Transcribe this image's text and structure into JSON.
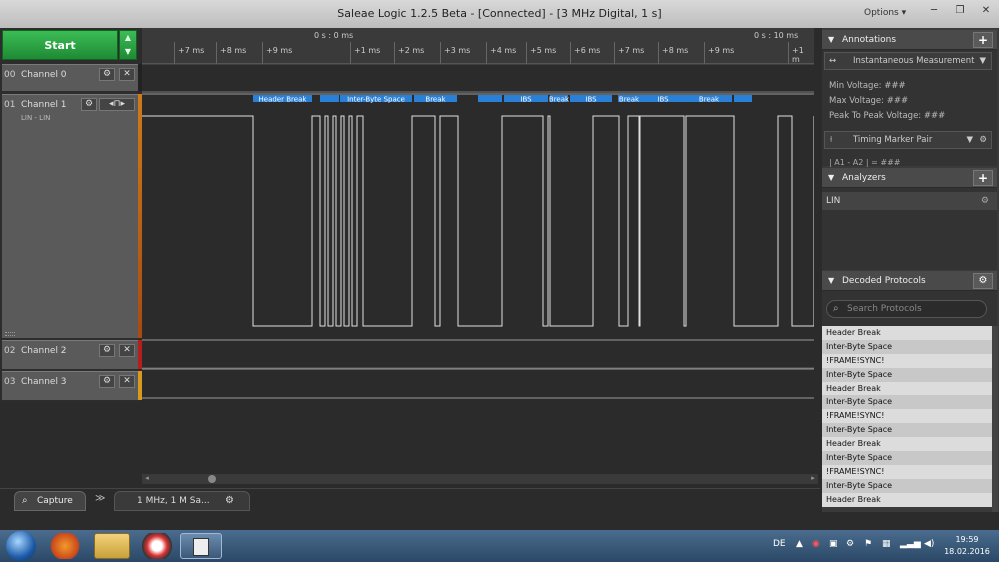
{
  "window": {
    "title": "Saleae Logic 1.2.5 Beta - [Connected] - [3 MHz Digital, 1 s]",
    "options_label": "Options ▾",
    "minimize": "─",
    "restore": "❐",
    "close": "✕"
  },
  "start_button": {
    "label": "Start",
    "arrows": "▲\n▼"
  },
  "channels": [
    {
      "num": "00",
      "name": "Channel 0",
      "sub": ""
    },
    {
      "num": "01",
      "name": "Channel 1",
      "sub": "LIN - LIN"
    },
    {
      "num": "02",
      "name": "Channel 2",
      "sub": ""
    },
    {
      "num": "03",
      "name": "Channel 3",
      "sub": ""
    }
  ],
  "channel_colors": [
    "#222222",
    "#c8741a",
    "#b41e1e",
    "#d89a1e"
  ],
  "ruler": {
    "center_label": "0 s : 0 ms",
    "right_label": "0 s : 10 ms",
    "ticks": [
      "+7 ms",
      "+8 ms",
      "+9 ms",
      "+1 ms",
      "+2 ms",
      "+3 ms",
      "+4 ms",
      "+5 ms",
      "+6 ms",
      "+7 ms",
      "+8 ms",
      "+9 ms",
      "+1 m"
    ]
  },
  "decoded_labels": [
    "Header Break",
    "Inter-Byte Space",
    "Break",
    "IBS",
    "Break",
    "IBS",
    "Break",
    "IBS",
    "Break"
  ],
  "bottom": {
    "capture_tab": "Capture",
    "capture_icon": "magnifier-icon",
    "chevron": "≫",
    "session_tab": "1 MHz, 1 M Sa...",
    "session_gear": "⚙"
  },
  "annotations": {
    "title": "Annotations",
    "instantaneous": "Instantaneous Measurement",
    "min_voltage": "Min Voltage: ###",
    "max_voltage": "Max Voltage: ###",
    "peak_to_peak": "Peak To Peak Voltage: ###",
    "timing_marker": "Timing Marker Pair",
    "marker_formula": "| A1 - A2 | = ###"
  },
  "analyzers": {
    "title": "Analyzers",
    "items": [
      "LIN"
    ]
  },
  "decoded_protocols": {
    "title": "Decoded Protocols",
    "search_placeholder": "Search Protocols",
    "items": [
      "Header Break",
      "Inter-Byte Space",
      "!FRAME!SYNC!",
      "Inter-Byte Space",
      "Header Break",
      "Inter-Byte Space",
      "!FRAME!SYNC!",
      "Inter-Byte Space",
      "Header Break",
      "Inter-Byte Space",
      "!FRAME!SYNC!",
      "Inter-Byte Space",
      "Header Break"
    ]
  },
  "taskbar": {
    "language": "DE",
    "time": "19:59",
    "date": "18.02.2016"
  },
  "colors": {
    "start_green": "#2aa444",
    "decode_blue": "#2a7fd6",
    "signal": "#e0e0e0"
  }
}
